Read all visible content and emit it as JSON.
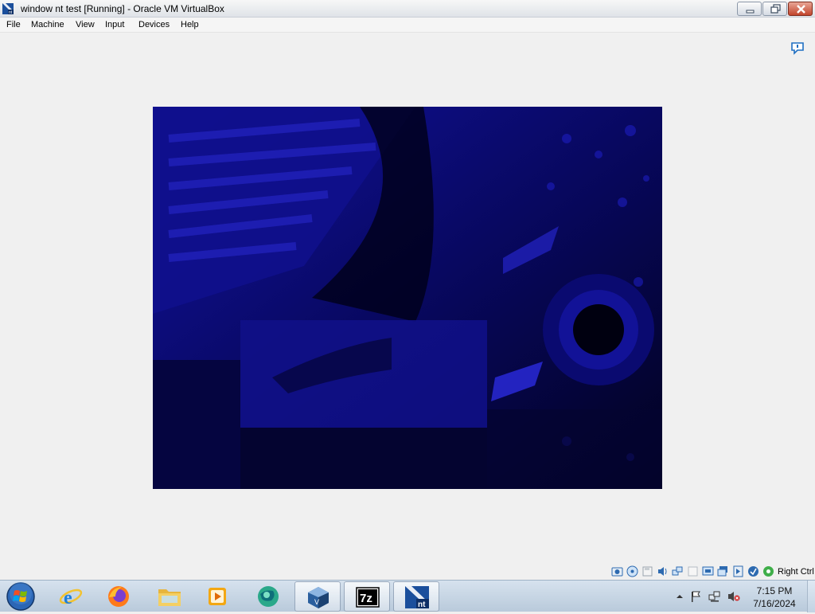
{
  "window": {
    "title": "window nt test [Running] - Oracle VM VirtualBox",
    "app_icon": "virtualbox-nt-icon",
    "controls": [
      "minimize-icon",
      "restore-icon",
      "close-icon"
    ]
  },
  "menubar": {
    "items": [
      {
        "label": "File"
      },
      {
        "label": "Machine"
      },
      {
        "label": "View"
      },
      {
        "label": "Input"
      },
      {
        "label": "Devices"
      },
      {
        "label": "Help"
      }
    ]
  },
  "notification": {
    "icon": "message-bubble-icon"
  },
  "vm_display": {
    "content": "guest-desktop-wallpaper",
    "dominant_color": "#0a0a8a"
  },
  "statusbar": {
    "icons": [
      "hard-disk-icon",
      "optical-drive-icon",
      "floppy-drive-icon",
      "audio-icon",
      "network-icon",
      "usb-icon",
      "shared-folders-icon",
      "display-icon",
      "video-capture-icon",
      "guest-additions-icon",
      "mouse-integration-icon",
      "keyboard-icon"
    ],
    "host_key_label": "Right Ctrl"
  },
  "taskbar": {
    "apps": [
      {
        "name": "internet-explorer",
        "icon": "internet-explorer-icon"
      },
      {
        "name": "firefox",
        "icon": "firefox-icon"
      },
      {
        "name": "file-explorer",
        "icon": "folder-icon"
      },
      {
        "name": "media-player",
        "icon": "media-player-icon"
      },
      {
        "name": "app-globe",
        "icon": "globe-app-icon"
      },
      {
        "name": "virtualbox",
        "icon": "virtualbox-icon"
      },
      {
        "name": "7-zip",
        "icon": "7zip-icon",
        "label": "7z"
      },
      {
        "name": "virtualbox-vm-window",
        "icon": "virtualbox-nt-icon",
        "label": "nt"
      }
    ],
    "tray": {
      "icons": [
        "show-hidden-icons-icon",
        "action-center-flag-icon",
        "network-status-icon",
        "volume-muted-icon"
      ],
      "time": "7:15 PM",
      "date": "7/16/2024"
    }
  },
  "colors": {
    "titlebar": "#dfe3e8",
    "client_background": "#f0f0f0",
    "taskbar": "#c3d3e3",
    "close_button": "#c2452c"
  }
}
